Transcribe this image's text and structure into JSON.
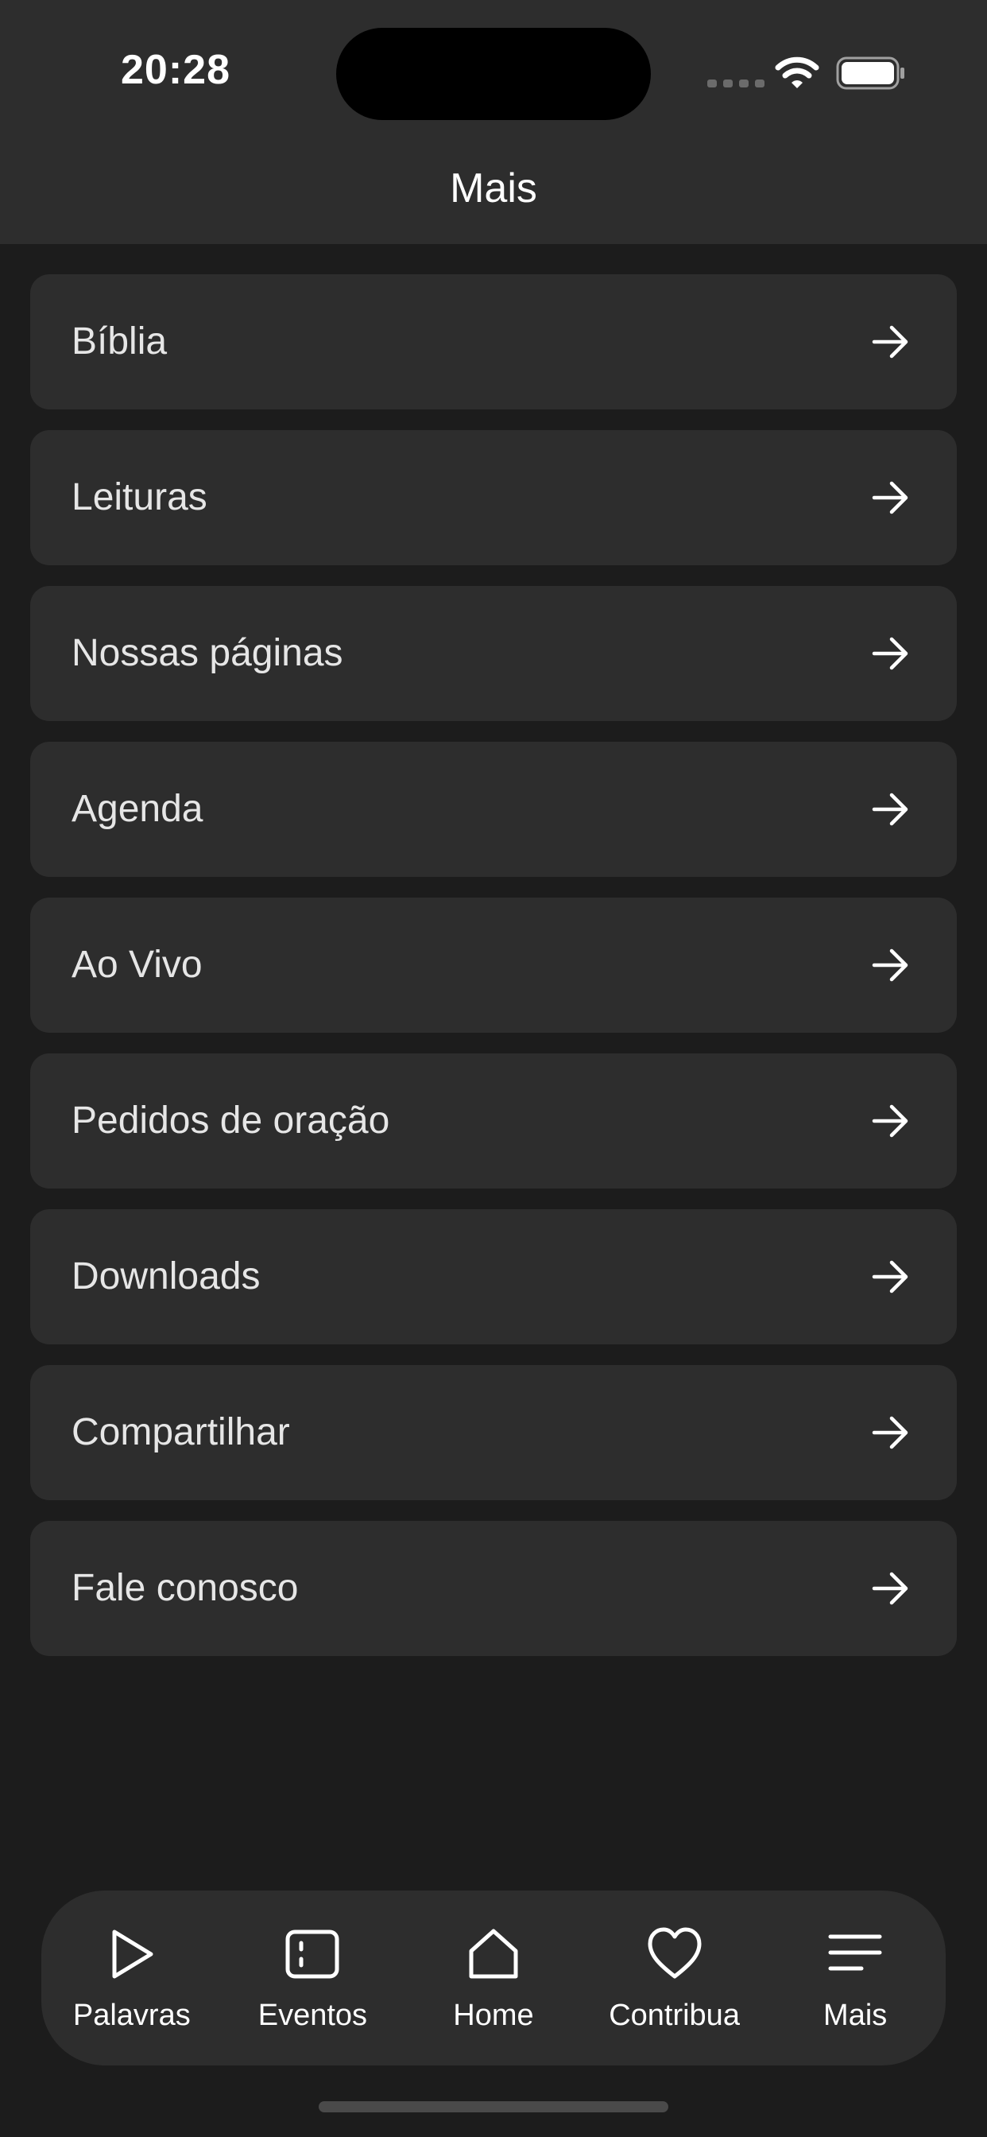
{
  "status_bar": {
    "time": "20:28"
  },
  "header": {
    "title": "Mais"
  },
  "menu": {
    "items": [
      {
        "label": "Bíblia"
      },
      {
        "label": "Leituras"
      },
      {
        "label": "Nossas páginas"
      },
      {
        "label": "Agenda"
      },
      {
        "label": "Ao Vivo"
      },
      {
        "label": "Pedidos de oração"
      },
      {
        "label": "Downloads"
      },
      {
        "label": "Compartilhar"
      },
      {
        "label": "Fale conosco"
      }
    ],
    "item_icon": "arrow-right-icon"
  },
  "tab_bar": {
    "tabs": [
      {
        "label": "Palavras",
        "icon": "play-icon"
      },
      {
        "label": "Eventos",
        "icon": "calendar-list-icon"
      },
      {
        "label": "Home",
        "icon": "home-icon"
      },
      {
        "label": "Contribua",
        "icon": "heart-icon"
      },
      {
        "label": "Mais",
        "icon": "menu-icon"
      }
    ]
  },
  "colors": {
    "background": "#1c1c1c",
    "surface": "#2d2d2d",
    "text": "#ffffff",
    "muted_text": "#e6e6e6"
  }
}
